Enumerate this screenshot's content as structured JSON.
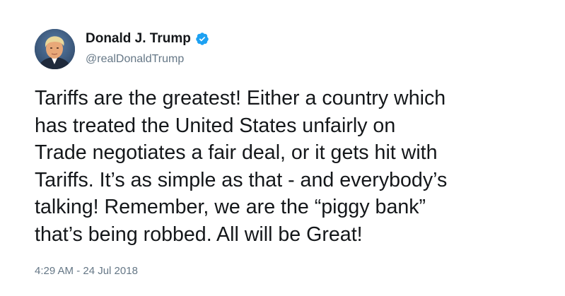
{
  "tweet": {
    "display_name": "Donald J. Trump",
    "handle": "@realDonaldTrump",
    "verified_icon": "verified-badge-icon",
    "lines": [
      "Tariffs are the greatest! Either a country which",
      "has treated the United States unfairly on",
      "Trade negotiates a fair deal, or it gets hit with",
      "Tariffs. It’s as simple as that - and everybody’s",
      "talking! Remember, we are the “piggy bank”",
      "that’s being robbed. All will be Great!"
    ],
    "timestamp": "4:29 AM - 24 Jul 2018"
  },
  "colors": {
    "text": "#14171a",
    "secondary_text": "#657786",
    "verified_blue": "#1da1f2",
    "background": "#ffffff"
  }
}
